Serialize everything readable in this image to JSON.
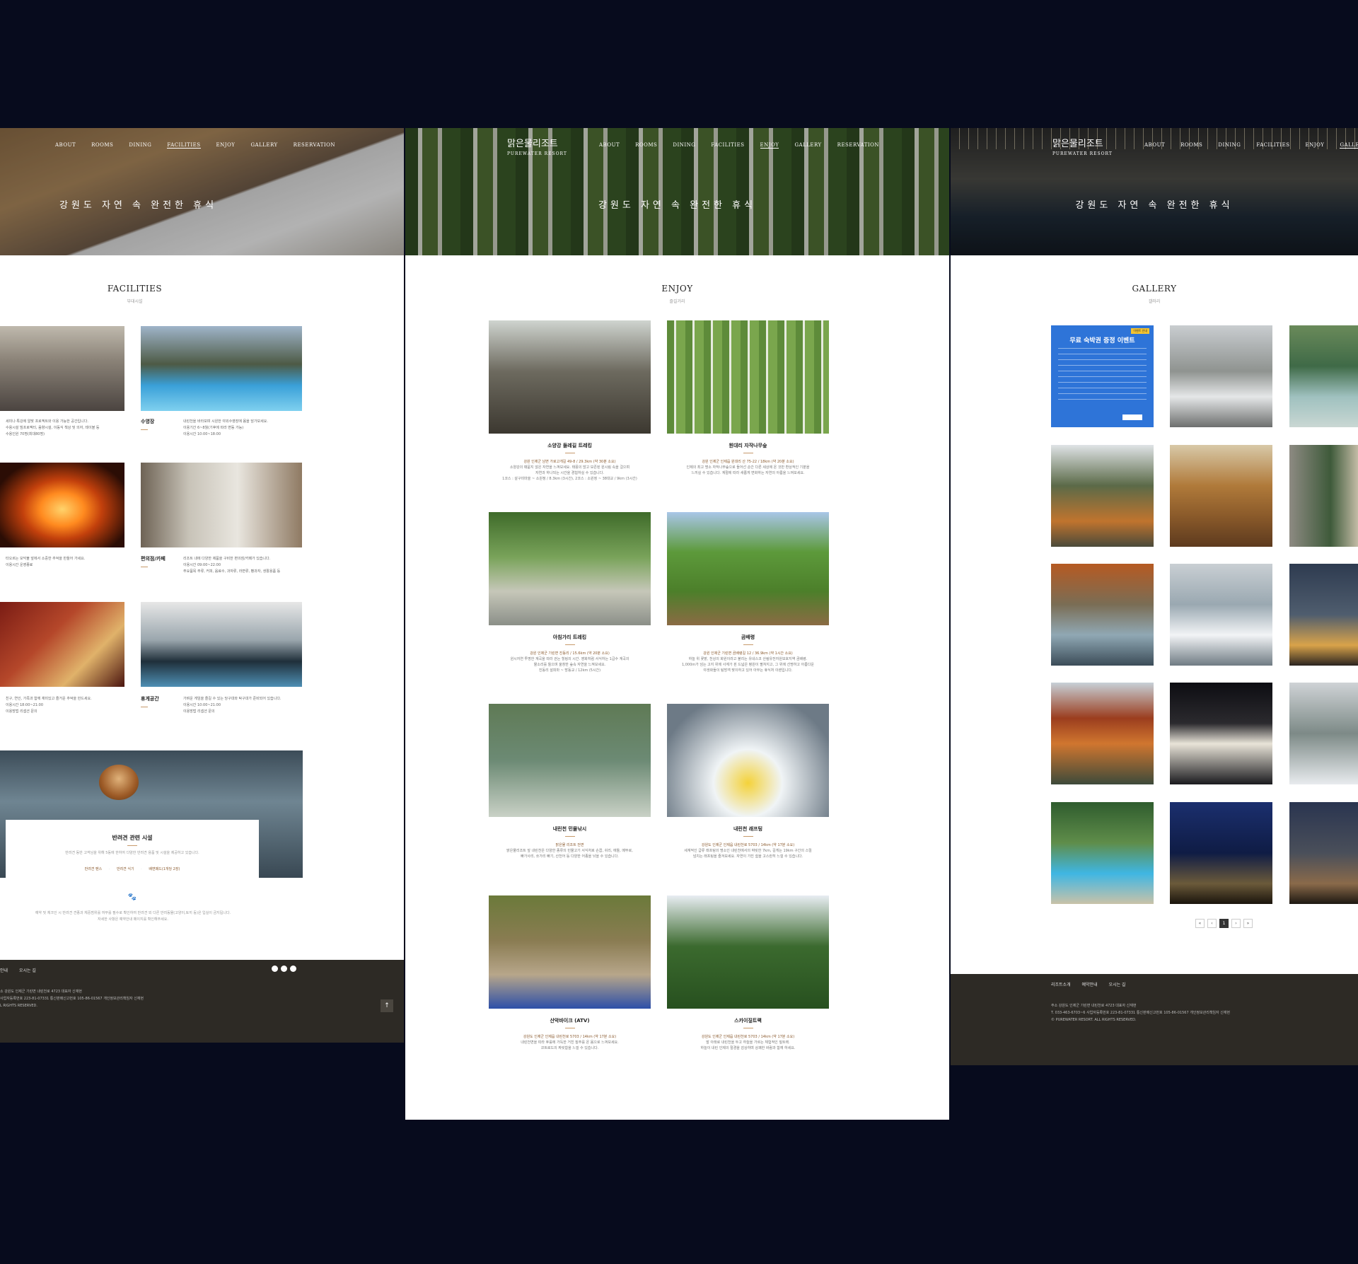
{
  "brand": {
    "name": "맑은물리조트",
    "name_en": "PUREWATER RESORT"
  },
  "nav": [
    "ABOUT",
    "ROOMS",
    "DINING",
    "FACILITIES",
    "ENJOY",
    "GALLERY",
    "RESERVATION"
  ],
  "tagline": "강원도 자연 속 완전한 휴식",
  "facilities": {
    "title": "FACILITIES",
    "subtitle": "부대시설",
    "items": [
      {
        "name": "",
        "desc": "세미나·특강에 알맞 프로젝트와 이용 가능한 공간입니다.",
        "rows": [
          "수용시설    빔프로젝터, 음향시설, 이동식 책상 및 의자, 테이블 등",
          "수용인원    70명(최대80명)"
        ]
      },
      {
        "name": "수영장",
        "desc": "내린천을 바라보며 시원한 야외수영장에 몸을 담가보세요.",
        "rows": [
          "이용기간    6~8월(기후에 따라 변동 가능)",
          "이용시간    10:00~18:00"
        ]
      },
      {
        "name": "",
        "desc": "타오르는 모닥불 앞에서 소중한 추억을 만들어 가세요.",
        "rows": [
          "이용시간    운영종료"
        ]
      },
      {
        "name": "편의점/카페",
        "desc": "리조트 내에 다양한 제품을 구비한 편의점/카페가 있습니다.",
        "rows": [
          "이용시간    09:00~22:00",
          "주요품목    주류, 커피, 음료수, 과자류, 라면류, 빵과자, 생활용품 등"
        ]
      },
      {
        "name": "",
        "desc": "친구, 연인, 가족과 함께 재미있고 즐거운 추억을 만드세요.",
        "rows": [
          "이용시간    18:00~21:00",
          "이용방법    리셉션 문의"
        ]
      },
      {
        "name": "휴게공간",
        "desc": "가벼운 게임을 즐길 수 있는 당구대와 탁구대가 준비되어 있습니다.",
        "rows": [
          "이용시간    10:00~21:00",
          "이용방법    리셉션 문의"
        ]
      }
    ],
    "pet": {
      "title": "반려견 관련 시설",
      "desc": "반려견 동반 고객님을 위해 5동에 한하여 다양한 반려견 용품 및 시설을 제공하고 있습니다.",
      "links": [
        "반려견 펜스",
        "반려견 식기",
        "배변패드(1개당 2장)"
      ],
      "note1": "예약 및 체크인 시 반려견 견종과 체중범위를 여부를 필수로 확인하여 반려견 외 다른 반려동물(고양이,토끼 등)은 입실이 금지됩니다.",
      "note2": "자세한 사항은 예약안내 페이지를 확인해주세요."
    }
  },
  "enjoy": {
    "title": "ENJOY",
    "subtitle": "즐길거리",
    "items": [
      {
        "name": "소양강 둘레길 트레킹",
        "loc": "강원 인제군 남면 가로고개길 49-8 / 29.3km (약 30분 소요)",
        "desc": [
          "소양강의 때묻지 않은 자연을 느껴보세요. 태풍의 많고 보존된 원시림 속을 걸으며",
          "자연과 하나되는 시간을 경험하실 수 있습니다.",
          "1코스 : 살구미마을 ~ 소원정 / 8.3km (3시간), 2코스 : 소원정 ~ 38대교 / 9km (3시간)"
        ]
      },
      {
        "name": "원대리 자작나무숲",
        "loc": "강원 인제군 인제읍 원대리 산 75-22 / 18km (약 20분 소요)",
        "desc": [
          "인제의 최고 명소 자작나무숲으로 들어선 순간 다른 세상에 온 것만 환상적인 기분을",
          "느끼실 수 있습니다. 계절에 따라 새롭게 변화하는 자연의 아름을 느껴보세요."
        ]
      },
      {
        "name": "아침가리 트레킹",
        "loc": "강원 인제군 기린면 진동리 / 15.6km (약 20분 소요)",
        "desc": [
          "원시자연 투명한 계곡을 따라 걷는 힐링의 시간. 영화처럼 서식하는 1급수 계곡의",
          "물소리를 들으며 울창한 숲속 자연을 느껴보세요.",
          "진동리 설피마 ~ 방동교 / 12km (5시간)"
        ]
      },
      {
        "name": "곰배령",
        "loc": "강원 인제군 기린면 곰배령길 12 / 36.9km (약 1시간 소요)",
        "desc": [
          "하늘 위 꽃밭, 천상의 화원이라고 불리는 유네스코 산림유전자원보호지역 곰배령.",
          "1,000m가 넘는 고지 위에 사계가 핀 드넓은 평원이 펼쳐지고, 그 위에 선명하고 아름다운",
          "야생화들이 탐방객 맞이하고 있어 아무는 휴식처 이렌입니다."
        ]
      },
      {
        "name": "내린천 민물낚시",
        "loc": "맑은물 리조트 전면",
        "desc": [
          "맑은물리조트 앞 내린천은 다양한 종류의 민물고기 서식처로 손꼽, 쉬리, 에돌, 메뚜로,",
          "빠가사리, 쏘가리 빠기, 산천어 등 다양한 어종을 낚을 수 있습니다."
        ]
      },
      {
        "name": "내린천 래프팅",
        "loc": "강원도 인제군 인제읍 내린천로 5703 / 14km (약 17분 소요)",
        "desc": [
          "세계적인 급류 래프팅의 명소인 내린천에서의 짜릿한 7km, 길게는 19km 구간의 스릴",
          "넘치는 래프팅을 즐겨보세요. 자연이 가진 쉼을 고스란히 느낄 수 있습니다."
        ]
      },
      {
        "name": "산악바이크 (ATV)",
        "loc": "강원도 인제군 인제읍 내린천로 5703 / 14km (약 17분 소요)",
        "desc": [
          "내린천변을 따라 후룰에 가득한 거친 질주를 온 몸으로 느껴보세요.",
          "코트로드의 짜릿함을 느낄 수 있습니다."
        ]
      },
      {
        "name": "스카이짚트랙",
        "loc": "강원도 인제군 인제읍 내린천로 5703 / 14km (약 17분 소요)",
        "desc": [
          "발 아래로 내린천을 두고 하늘을 가르는 체험적인 짚트랙.",
          "하늘이 내린 인제의 절경을 감상하며 상쾌한 바람과 함께 하세요."
        ]
      }
    ]
  },
  "gallery": {
    "title": "GALLERY",
    "subtitle": "갤러리",
    "event_title": "무료 숙박권 증정 이벤트",
    "event_badge": "이벤트 안내",
    "pager": [
      "«",
      "‹",
      "1",
      "›",
      "»"
    ]
  },
  "footer": {
    "links": [
      "리조트소개",
      "예약안내",
      "오시는 길"
    ],
    "links_p1": [
      "안내",
      "오시는 길"
    ],
    "address": "주소  강원도 인제군 기린면 내린천로 4723    대표자  신재현",
    "phone": "T. 033-463-6703~6    사업자등록번호  223-81-07331    통신판매신고번호  105-86-01567    개인정보관리책임자  신재현",
    "copyright": "© PUREWATER RESORT. ALL RIGHTS RESERVED.",
    "p1_addr": "소  강원도 인제군 기린면 내린천로 4723    대표자  신재현",
    "p1_phone": "사업자등록번호  223-81-07331    통신판매신고번호  105-86-01567    개인정보관리책임자  신재현",
    "p1_copy": "L RIGHTS RESERVED.",
    "top_label": "↑"
  },
  "colors": {
    "background": "#070b1d",
    "footer": "#2d2a25",
    "accent": "#c79a6b",
    "event_blue": "#2e74d8"
  }
}
